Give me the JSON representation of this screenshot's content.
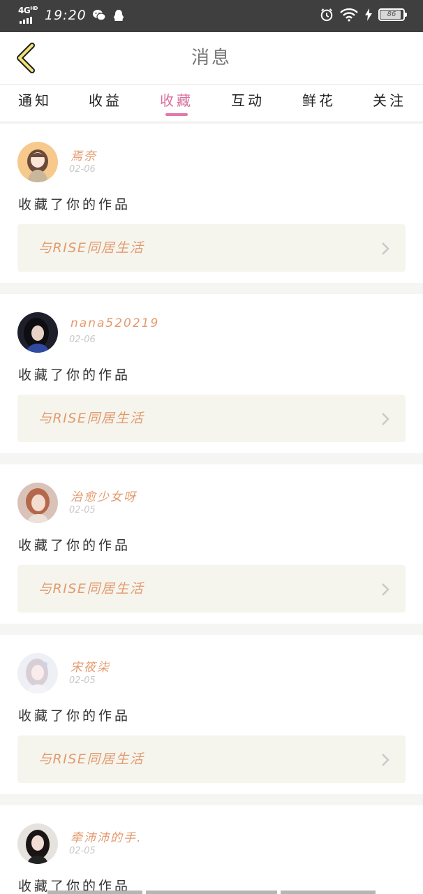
{
  "status_bar": {
    "network": "4G",
    "network_sup": "HD",
    "time": "19:20",
    "battery": "86"
  },
  "header": {
    "title": "消息"
  },
  "tabs": [
    {
      "label": "通知"
    },
    {
      "label": "收益"
    },
    {
      "label": "收藏"
    },
    {
      "label": "互动"
    },
    {
      "label": "鲜花"
    },
    {
      "label": "关注"
    }
  ],
  "active_tab": "收藏",
  "notifications": [
    {
      "username": "焉奈",
      "date": "02-06",
      "action": "收藏了你的作品",
      "work_title": "与RISE同居生活"
    },
    {
      "username": "nana520219",
      "date": "02-06",
      "action": "收藏了你的作品",
      "work_title": "与RISE同居生活"
    },
    {
      "username": "治愈少女呀",
      "date": "02-05",
      "action": "收藏了你的作品",
      "work_title": "与RISE同居生活"
    },
    {
      "username": "宋筱柒",
      "date": "02-05",
      "action": "收藏了你的作品",
      "work_title": "与RISE同居生活"
    },
    {
      "username": "牵沛沛的手.",
      "date": "02-05",
      "action": "收藏了你的作品",
      "work_title": ""
    }
  ],
  "colors": {
    "accent_pink": "#e07aa8",
    "username_orange": "#e39a6e",
    "link_bg": "#f5f5ee"
  }
}
